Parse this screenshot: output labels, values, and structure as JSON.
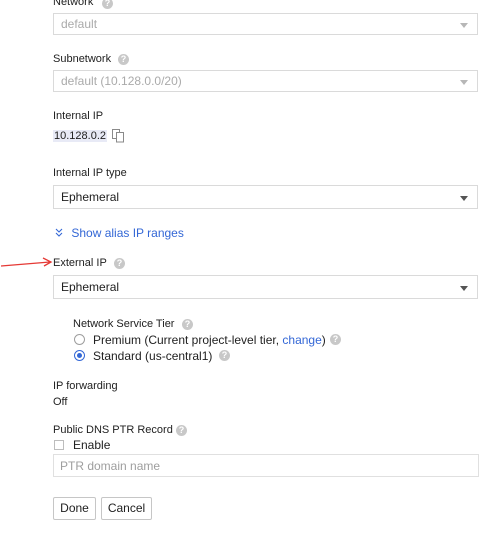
{
  "network": {
    "label": "Network",
    "value": "default"
  },
  "subnetwork": {
    "label": "Subnetwork",
    "value": "default (10.128.0.0/20)"
  },
  "internal_ip": {
    "label": "Internal IP",
    "value": "10.128.0.2"
  },
  "internal_ip_type": {
    "label": "Internal IP type",
    "value": "Ephemeral"
  },
  "alias": {
    "label": "Show alias IP ranges"
  },
  "external_ip": {
    "label": "External IP",
    "value": "Ephemeral"
  },
  "tier": {
    "label": "Network Service Tier",
    "premium_label": "Premium (Current project-level tier, ",
    "premium_link": "change",
    "premium_close": ")",
    "standard_label": "Standard (us-central1)",
    "selected": "standard"
  },
  "ip_forwarding": {
    "label": "IP forwarding",
    "value": "Off"
  },
  "dns": {
    "label": "Public DNS PTR Record",
    "enable_label": "Enable",
    "placeholder": "PTR domain name"
  },
  "buttons": {
    "done": "Done",
    "cancel": "Cancel"
  },
  "help_glyph": "?",
  "colors": {
    "link": "#3367d6",
    "arrow": "#e53935"
  }
}
